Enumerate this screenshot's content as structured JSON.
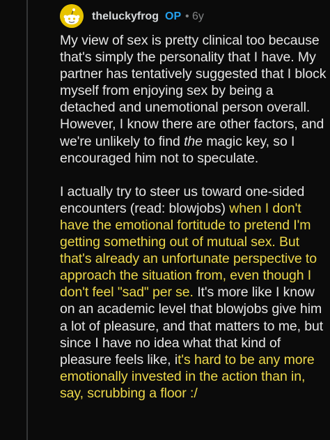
{
  "comment": {
    "username": "theluckyfrog",
    "op_badge": "OP",
    "separator": "•",
    "age": "6y",
    "paragraph1": {
      "text_before": "My view of sex is pretty clinical too because that's simply the personality that I have.  My partner has tentatively suggested that I block myself from enjoying sex by being a detached and unemotional person overall.  However, I know there are other factors, and we're unlikely to find ",
      "italic": "the",
      "text_after": " magic key, so I encouraged him not to speculate."
    },
    "paragraph2": {
      "plain1": "I actually try to steer us toward one-sided encounters (read: blowjobs) ",
      "highlight1": "when I don't have the emotional fortitude to pretend I'm getting something out of mutual sex.  But that's already an unfortunate perspective to approach the situation from, even though I don't feel \"sad\" per se.",
      "plain2": "  It's more like I know on an academic level that blowjobs give him a lot of pleasure, and that matters to me, but since I have no idea what that kind of pleasure feels like, i",
      "highlight2": "t's hard to be any more emotionally invested in the action than in, say, scrubbing a floor :/"
    },
    "colors": {
      "background": "#0b0b0b",
      "text": "#e6e6e6",
      "highlight_text": "#ecd84a",
      "op_badge": "#24a0ed",
      "avatar": "#e7c300"
    }
  }
}
